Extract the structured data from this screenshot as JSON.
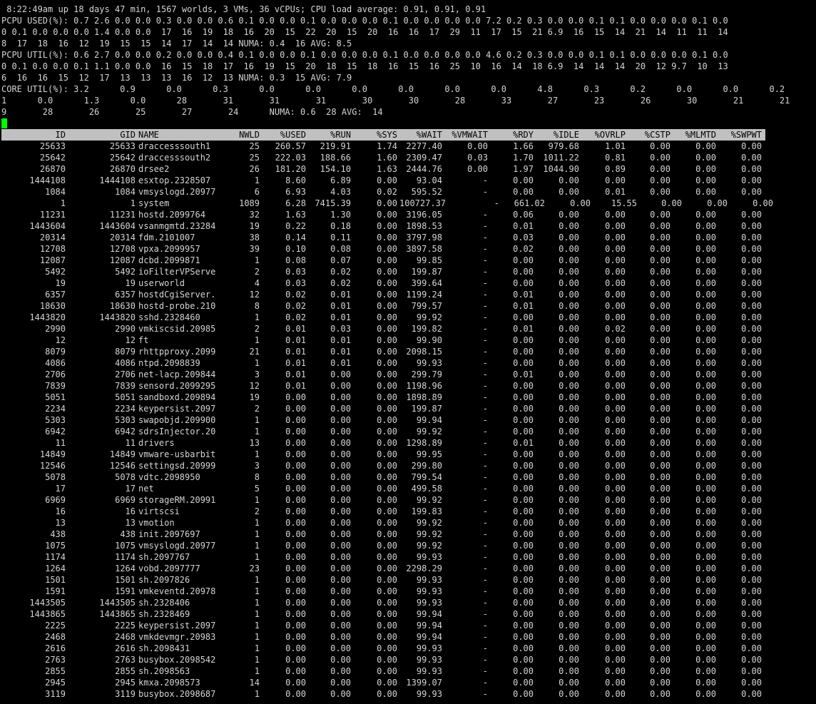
{
  "header_lines": [
    " 8:22:49am up 18 days 47 min, 1567 worlds, 3 VMs, 36 vCPUs; CPU load average: 0.91, 0.91, 0.91",
    "PCPU USED(%): 0.7 2.6 0.0 0.0 0.3 0.0 0.0 0.6 0.1 0.0 0.0 0.1 0.0 0.0 0.0 0.1 0.0 0.0 0.0 0.0 7.2 0.2 0.3 0.0 0.0 0.1 0.1 0.0 0.0 0.0 0.1 0.0",
    "0 0.1 0.0 0.0 0.0 1.4 0.0 0.0  17  16  19  18  16  20  15  22  20  15  20  16  16  17  29  11  17  15  21 6.9  16  15  14  21  14  11  11  14",
    "8  17  18  16  12  19  15  15  14  17  14  14 NUMA: 0.4  16 AVG: 8.5",
    "PCPU UTIL(%): 0.6 2.7 0.0 0.0 0.2 0.0 0.0 0.4 0.1 0.0 0.0 0.1 0.0 0.0 0.0 0.1 0.0 0.0 0.0 0.0 4.6 0.2 0.3 0.0 0.0 0.1 0.1 0.0 0.0 0.0 0.1 0.0",
    "0 0.1 0.0 0.0 0.1 1.1 0.0 0.0  16  15  18  17  16  19  15  20  18  15  18  16  15  16  25  10  16  14  18 6.9  14  14  14  20  12 9.7  10  13",
    "6  16  16  15  12  17  13  13  13  16  12  13 NUMA: 0.3  15 AVG: 7.9",
    "CORE UTIL(%): 3.2      0.9      0.0      0.3      0.0      0.0      0.0      0.0      0.0      0.0      4.8      0.3      0.2      0.0      0.0      0.2      0.0",
    "1      0.0      1.3      0.0      28       31       31       31       30       30       28       33       27       23       26       30       21       21",
    "9       28       26       25       27       24      NUMA: 0.6  28 AVG:  14"
  ],
  "columns": [
    "ID",
    "GID",
    "NAME",
    "NWLD",
    "%USED",
    "%RUN",
    "%SYS",
    "%WAIT",
    "%VMWAIT",
    "%RDY",
    "%IDLE",
    "%OVRLP",
    "%CSTP",
    "%MLMTD",
    "%SWPWT"
  ],
  "rows": [
    [
      "25633",
      "25633",
      "draccesssouth1",
      "25",
      "260.57",
      "219.91",
      "1.74",
      "2277.40",
      "0.00",
      "1.66",
      "979.68",
      "1.01",
      "0.00",
      "0.00",
      "0.00"
    ],
    [
      "25642",
      "25642",
      "draccesssouth2",
      "25",
      "222.03",
      "188.66",
      "1.60",
      "2309.47",
      "0.03",
      "1.70",
      "1011.22",
      "0.81",
      "0.00",
      "0.00",
      "0.00"
    ],
    [
      "26870",
      "26870",
      "drsee2",
      "26",
      "181.20",
      "154.10",
      "1.63",
      "2444.76",
      "0.00",
      "1.97",
      "1044.90",
      "0.89",
      "0.00",
      "0.00",
      "0.00"
    ],
    [
      "1444108",
      "1444108",
      "esxtop.2328507",
      "1",
      "8.60",
      "6.89",
      "0.00",
      "93.04",
      "-",
      "0.00",
      "0.00",
      "0.00",
      "0.00",
      "0.00",
      "0.00"
    ],
    [
      "1084",
      "1084",
      "vmsyslogd.20977",
      "6",
      "6.93",
      "4.03",
      "0.02",
      "595.52",
      "-",
      "0.00",
      "0.00",
      "0.01",
      "0.00",
      "0.00",
      "0.00"
    ],
    [
      "1",
      "1",
      "system",
      "1089",
      "6.28",
      "7415.39",
      "0.00",
      "100727.37",
      "-",
      "661.02",
      "0.00",
      "15.55",
      "0.00",
      "0.00",
      "0.00"
    ],
    [
      "11231",
      "11231",
      "hostd.2099764",
      "32",
      "1.63",
      "1.30",
      "0.00",
      "3196.05",
      "-",
      "0.06",
      "0.00",
      "0.00",
      "0.00",
      "0.00",
      "0.00"
    ],
    [
      "1443604",
      "1443604",
      "vsanmgmtd.23284",
      "19",
      "0.22",
      "0.18",
      "0.00",
      "1898.53",
      "-",
      "0.01",
      "0.00",
      "0.00",
      "0.00",
      "0.00",
      "0.00"
    ],
    [
      "20314",
      "20314",
      "fdm.2101007",
      "38",
      "0.14",
      "0.11",
      "0.00",
      "3797.98",
      "-",
      "0.03",
      "0.00",
      "0.00",
      "0.00",
      "0.00",
      "0.00"
    ],
    [
      "12708",
      "12708",
      "vpxa.2099957",
      "39",
      "0.10",
      "0.08",
      "0.00",
      "3897.58",
      "-",
      "0.02",
      "0.00",
      "0.00",
      "0.00",
      "0.00",
      "0.00"
    ],
    [
      "12087",
      "12087",
      "dcbd.2099871",
      "1",
      "0.08",
      "0.07",
      "0.00",
      "99.85",
      "-",
      "0.00",
      "0.00",
      "0.00",
      "0.00",
      "0.00",
      "0.00"
    ],
    [
      "5492",
      "5492",
      "ioFilterVPServe",
      "2",
      "0.03",
      "0.02",
      "0.00",
      "199.87",
      "-",
      "0.00",
      "0.00",
      "0.00",
      "0.00",
      "0.00",
      "0.00"
    ],
    [
      "19",
      "19",
      "userworld",
      "4",
      "0.03",
      "0.02",
      "0.00",
      "399.64",
      "-",
      "0.00",
      "0.00",
      "0.00",
      "0.00",
      "0.00",
      "0.00"
    ],
    [
      "6357",
      "6357",
      "hostdCgiServer.",
      "12",
      "0.02",
      "0.01",
      "0.00",
      "1199.24",
      "-",
      "0.01",
      "0.00",
      "0.00",
      "0.00",
      "0.00",
      "0.00"
    ],
    [
      "18630",
      "18630",
      "hostd-probe.210",
      "8",
      "0.02",
      "0.01",
      "0.00",
      "799.57",
      "-",
      "0.01",
      "0.00",
      "0.00",
      "0.00",
      "0.00",
      "0.00"
    ],
    [
      "1443820",
      "1443820",
      "sshd.2328460",
      "1",
      "0.02",
      "0.01",
      "0.00",
      "99.92",
      "-",
      "0.00",
      "0.00",
      "0.00",
      "0.00",
      "0.00",
      "0.00"
    ],
    [
      "2990",
      "2990",
      "vmkiscsid.20985",
      "2",
      "0.01",
      "0.03",
      "0.00",
      "199.82",
      "-",
      "0.01",
      "0.00",
      "0.02",
      "0.00",
      "0.00",
      "0.00"
    ],
    [
      "12",
      "12",
      "ft",
      "1",
      "0.01",
      "0.01",
      "0.00",
      "99.90",
      "-",
      "0.00",
      "0.00",
      "0.00",
      "0.00",
      "0.00",
      "0.00"
    ],
    [
      "8079",
      "8079",
      "rhttpproxy.2099",
      "21",
      "0.01",
      "0.01",
      "0.00",
      "2098.15",
      "-",
      "0.00",
      "0.00",
      "0.00",
      "0.00",
      "0.00",
      "0.00"
    ],
    [
      "4086",
      "4086",
      "ntpd.2098839",
      "1",
      "0.01",
      "0.01",
      "0.00",
      "99.93",
      "-",
      "0.00",
      "0.00",
      "0.00",
      "0.00",
      "0.00",
      "0.00"
    ],
    [
      "2706",
      "2706",
      "net-lacp.209844",
      "3",
      "0.01",
      "0.00",
      "0.00",
      "299.79",
      "-",
      "0.01",
      "0.00",
      "0.00",
      "0.00",
      "0.00",
      "0.00"
    ],
    [
      "7839",
      "7839",
      "sensord.2099295",
      "12",
      "0.01",
      "0.00",
      "0.00",
      "1198.96",
      "-",
      "0.00",
      "0.00",
      "0.00",
      "0.00",
      "0.00",
      "0.00"
    ],
    [
      "5051",
      "5051",
      "sandboxd.209894",
      "19",
      "0.00",
      "0.00",
      "0.00",
      "1898.89",
      "-",
      "0.00",
      "0.00",
      "0.00",
      "0.00",
      "0.00",
      "0.00"
    ],
    [
      "2234",
      "2234",
      "keypersist.2097",
      "2",
      "0.00",
      "0.00",
      "0.00",
      "199.87",
      "-",
      "0.00",
      "0.00",
      "0.00",
      "0.00",
      "0.00",
      "0.00"
    ],
    [
      "5303",
      "5303",
      "swapobjd.209900",
      "1",
      "0.00",
      "0.00",
      "0.00",
      "99.94",
      "-",
      "0.00",
      "0.00",
      "0.00",
      "0.00",
      "0.00",
      "0.00"
    ],
    [
      "6942",
      "6942",
      "sdrsInjector.20",
      "1",
      "0.00",
      "0.00",
      "0.00",
      "99.92",
      "-",
      "0.00",
      "0.00",
      "0.00",
      "0.00",
      "0.00",
      "0.00"
    ],
    [
      "11",
      "11",
      "drivers",
      "13",
      "0.00",
      "0.00",
      "0.00",
      "1298.89",
      "-",
      "0.01",
      "0.00",
      "0.00",
      "0.00",
      "0.00",
      "0.00"
    ],
    [
      "14849",
      "14849",
      "vmware-usbarbit",
      "1",
      "0.00",
      "0.00",
      "0.00",
      "99.95",
      "-",
      "0.00",
      "0.00",
      "0.00",
      "0.00",
      "0.00",
      "0.00"
    ],
    [
      "12546",
      "12546",
      "settingsd.20999",
      "3",
      "0.00",
      "0.00",
      "0.00",
      "299.80",
      "-",
      "0.00",
      "0.00",
      "0.00",
      "0.00",
      "0.00",
      "0.00"
    ],
    [
      "5078",
      "5078",
      "vdtc.2098950",
      "8",
      "0.00",
      "0.00",
      "0.00",
      "799.54",
      "-",
      "0.00",
      "0.00",
      "0.00",
      "0.00",
      "0.00",
      "0.00"
    ],
    [
      "17",
      "17",
      "net",
      "5",
      "0.00",
      "0.00",
      "0.00",
      "499.58",
      "-",
      "0.00",
      "0.00",
      "0.00",
      "0.00",
      "0.00",
      "0.00"
    ],
    [
      "6969",
      "6969",
      "storageRM.20991",
      "1",
      "0.00",
      "0.00",
      "0.00",
      "99.92",
      "-",
      "0.00",
      "0.00",
      "0.00",
      "0.00",
      "0.00",
      "0.00"
    ],
    [
      "16",
      "16",
      "virtscsi",
      "2",
      "0.00",
      "0.00",
      "0.00",
      "199.83",
      "-",
      "0.00",
      "0.00",
      "0.00",
      "0.00",
      "0.00",
      "0.00"
    ],
    [
      "13",
      "13",
      "vmotion",
      "1",
      "0.00",
      "0.00",
      "0.00",
      "99.92",
      "-",
      "0.00",
      "0.00",
      "0.00",
      "0.00",
      "0.00",
      "0.00"
    ],
    [
      "438",
      "438",
      "init.2097697",
      "1",
      "0.00",
      "0.00",
      "0.00",
      "99.92",
      "-",
      "0.00",
      "0.00",
      "0.00",
      "0.00",
      "0.00",
      "0.00"
    ],
    [
      "1075",
      "1075",
      "vmsyslogd.20977",
      "1",
      "0.00",
      "0.00",
      "0.00",
      "99.92",
      "-",
      "0.00",
      "0.00",
      "0.00",
      "0.00",
      "0.00",
      "0.00"
    ],
    [
      "1174",
      "1174",
      "sh.2097767",
      "1",
      "0.00",
      "0.00",
      "0.00",
      "99.93",
      "-",
      "0.00",
      "0.00",
      "0.00",
      "0.00",
      "0.00",
      "0.00"
    ],
    [
      "1264",
      "1264",
      "vobd.2097777",
      "23",
      "0.00",
      "0.00",
      "0.00",
      "2298.29",
      "-",
      "0.00",
      "0.00",
      "0.00",
      "0.00",
      "0.00",
      "0.00"
    ],
    [
      "1501",
      "1501",
      "sh.2097826",
      "1",
      "0.00",
      "0.00",
      "0.00",
      "99.93",
      "-",
      "0.00",
      "0.00",
      "0.00",
      "0.00",
      "0.00",
      "0.00"
    ],
    [
      "1591",
      "1591",
      "vmkeventd.20978",
      "1",
      "0.00",
      "0.00",
      "0.00",
      "99.93",
      "-",
      "0.00",
      "0.00",
      "0.00",
      "0.00",
      "0.00",
      "0.00"
    ],
    [
      "1443505",
      "1443505",
      "sh.2328406",
      "1",
      "0.00",
      "0.00",
      "0.00",
      "99.93",
      "-",
      "0.00",
      "0.00",
      "0.00",
      "0.00",
      "0.00",
      "0.00"
    ],
    [
      "1443865",
      "1443865",
      "sh.2328469",
      "1",
      "0.00",
      "0.00",
      "0.00",
      "99.94",
      "-",
      "0.00",
      "0.00",
      "0.00",
      "0.00",
      "0.00",
      "0.00"
    ],
    [
      "2225",
      "2225",
      "keypersist.2097",
      "1",
      "0.00",
      "0.00",
      "0.00",
      "99.94",
      "-",
      "0.00",
      "0.00",
      "0.00",
      "0.00",
      "0.00",
      "0.00"
    ],
    [
      "2468",
      "2468",
      "vmkdevmgr.20983",
      "1",
      "0.00",
      "0.00",
      "0.00",
      "99.94",
      "-",
      "0.00",
      "0.00",
      "0.00",
      "0.00",
      "0.00",
      "0.00"
    ],
    [
      "2616",
      "2616",
      "sh.2098431",
      "1",
      "0.00",
      "0.00",
      "0.00",
      "99.93",
      "-",
      "0.00",
      "0.00",
      "0.00",
      "0.00",
      "0.00",
      "0.00"
    ],
    [
      "2763",
      "2763",
      "busybox.2098542",
      "1",
      "0.00",
      "0.00",
      "0.00",
      "99.93",
      "-",
      "0.00",
      "0.00",
      "0.00",
      "0.00",
      "0.00",
      "0.00"
    ],
    [
      "2855",
      "2855",
      "sh.2098563",
      "1",
      "0.00",
      "0.00",
      "0.00",
      "99.93",
      "-",
      "0.00",
      "0.00",
      "0.00",
      "0.00",
      "0.00",
      "0.00"
    ],
    [
      "2945",
      "2945",
      "kmxa.2098573",
      "14",
      "0.00",
      "0.00",
      "0.00",
      "1399.07",
      "-",
      "0.00",
      "0.00",
      "0.00",
      "0.00",
      "0.00",
      "0.00"
    ],
    [
      "3119",
      "3119",
      "busybox.2098687",
      "1",
      "0.00",
      "0.00",
      "0.00",
      "99.93",
      "-",
      "0.00",
      "0.00",
      "0.00",
      "0.00",
      "0.00",
      "0.00"
    ]
  ]
}
